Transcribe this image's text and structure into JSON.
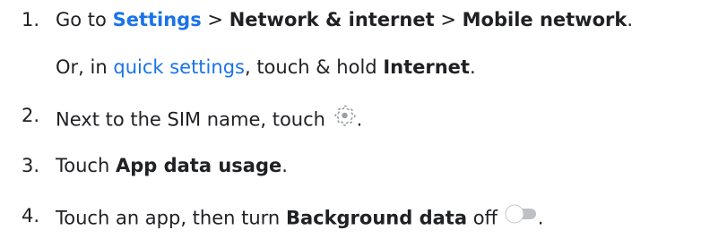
{
  "steps": [
    {
      "number": "1.",
      "prefix": "Go to",
      "link": "Settings",
      "sep1": ">",
      "item2": "Network & internet",
      "sep2": ">",
      "item3": "Mobile network",
      "end": ".",
      "alt_prefix": "Or, in",
      "alt_link": "quick settings",
      "alt_mid": ", touch & hold",
      "alt_bold": "Internet",
      "alt_end": "."
    },
    {
      "number": "2.",
      "text": "Next to the SIM name, touch",
      "icon": "gear-icon",
      "end": "."
    },
    {
      "number": "3.",
      "prefix": "Touch",
      "bold": "App data usage",
      "end": "."
    },
    {
      "number": "4.",
      "prefix": "Touch an app, then turn",
      "bold": "Background data",
      "suffix": "off",
      "icon": "toggle-off-icon",
      "end": "."
    }
  ],
  "colors": {
    "text": "#202124",
    "link": "#1a73e8",
    "icon": "#9aa0a6"
  }
}
